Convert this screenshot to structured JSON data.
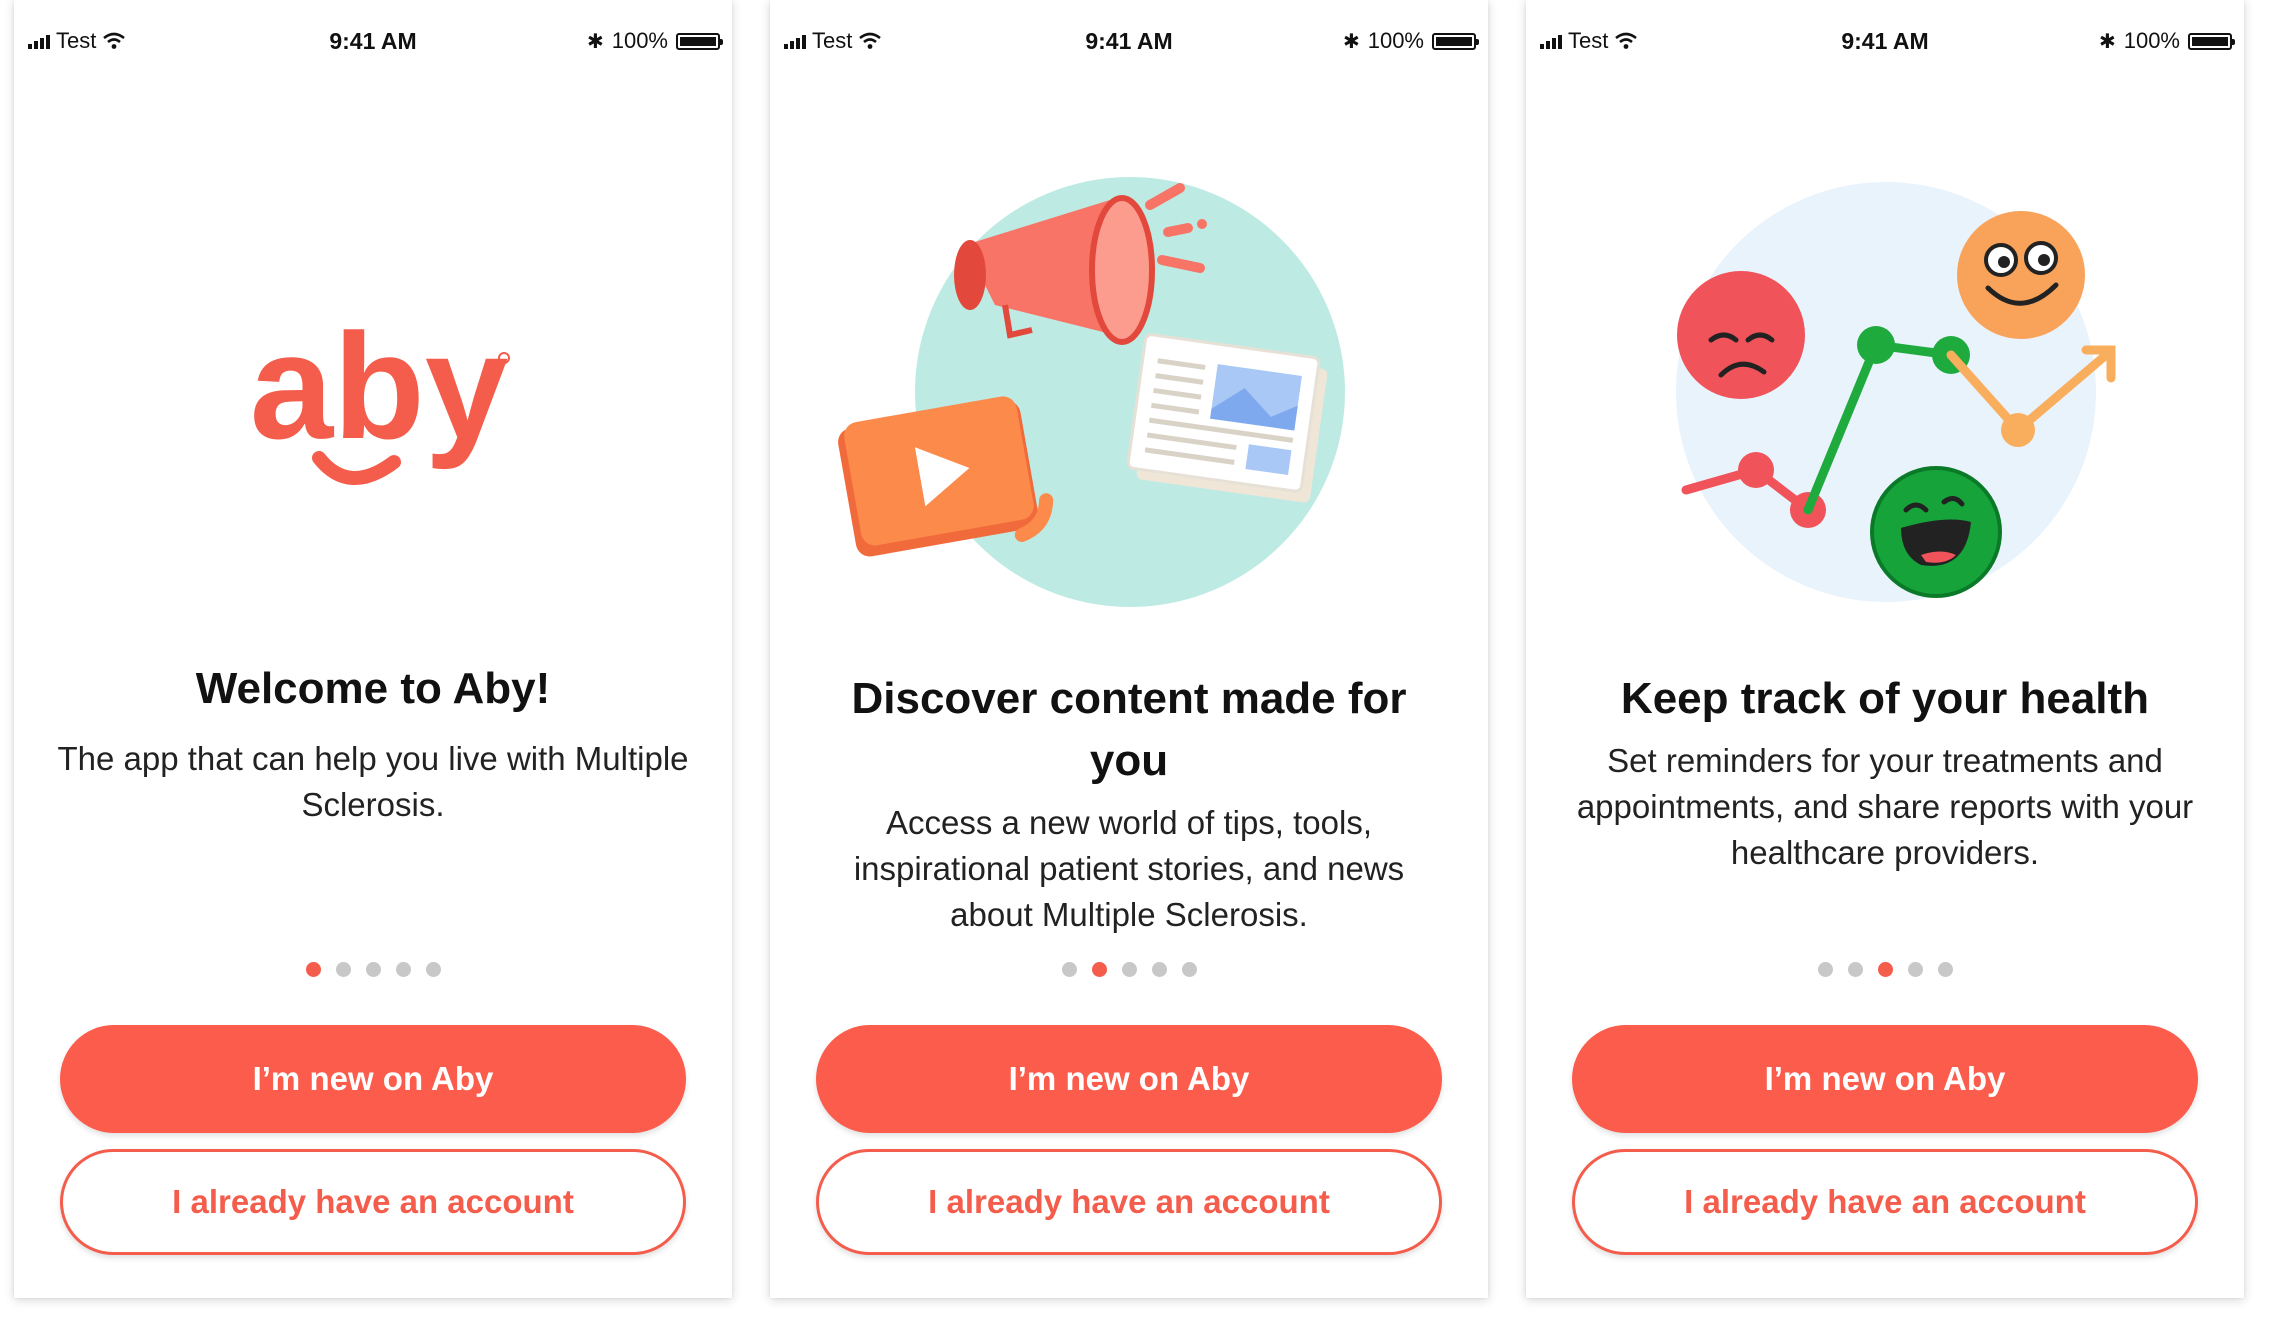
{
  "colors": {
    "accent": "#FB5C4B",
    "inactive_dot": "#C8C8C8",
    "text": "#111111"
  },
  "screens": [
    {
      "status": {
        "carrier": "Test",
        "time": "9:41 AM",
        "battery": "100%"
      },
      "logo_text": "aby",
      "title": "Welcome to Aby!",
      "description": "The app that can help you live with Multiple Sclerosis.",
      "page_index": 1,
      "page_count": 5,
      "primary_button": "I’m new on Aby",
      "secondary_button": "I already have an account"
    },
    {
      "status": {
        "carrier": "Test",
        "time": "9:41 AM",
        "battery": "100%"
      },
      "illustration": "megaphone-video-news-illustration",
      "title": "Discover content made for you",
      "description": "Access a new world of tips, tools, inspirational patient stories, and news about Multiple Sclerosis.",
      "page_index": 2,
      "page_count": 5,
      "primary_button": "I’m new on Aby",
      "secondary_button": "I already have an account"
    },
    {
      "status": {
        "carrier": "Test",
        "time": "9:41 AM",
        "battery": "100%"
      },
      "illustration": "mood-chart-illustration",
      "title": "Keep track of your health",
      "description": "Set reminders for your treatments and appointments, and share reports with your healthcare providers.",
      "page_index": 3,
      "page_count": 5,
      "primary_button": "I’m new on Aby",
      "secondary_button": "I already have an account"
    }
  ]
}
